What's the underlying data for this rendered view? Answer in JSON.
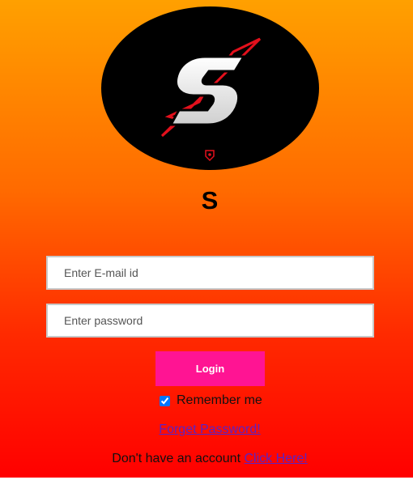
{
  "brand": {
    "title": "S"
  },
  "login_form": {
    "email_placeholder": "Enter E-mail id",
    "password_placeholder": "Enter password",
    "login_label": "Login",
    "remember_label": "Remember me",
    "remember_checked": true,
    "forgot_label": "Forget Password!",
    "signup_prompt": "Don't have an account",
    "signup_link_label": "Click Here!"
  },
  "colors": {
    "gradient_top": "#ffa000",
    "gradient_bottom": "#ff0000",
    "login_button": "#ff1493",
    "link": "#5b22c4",
    "logo_red": "#e3101c"
  },
  "icons": {
    "logo": "stylized-s-logo",
    "small_badge": "shield-badge-icon"
  }
}
